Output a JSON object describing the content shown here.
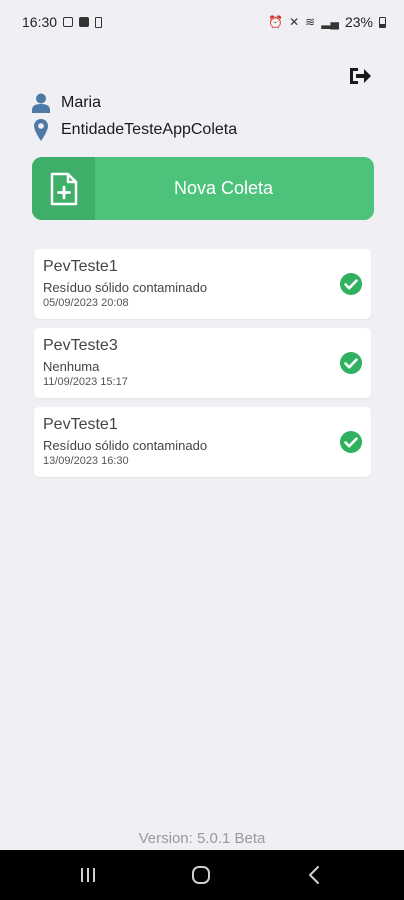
{
  "status_bar": {
    "time": "16:30",
    "battery": "23%"
  },
  "user": {
    "name": "Maria",
    "entity": "EntidadeTesteAppColeta"
  },
  "new_collection": {
    "label": "Nova Coleta"
  },
  "collections": [
    {
      "title": "PevTeste1",
      "description": "Resíduo sólido contaminado",
      "date": "05/09/2023 20:08",
      "status": "check-circle-icon"
    },
    {
      "title": "PevTeste3",
      "description": "Nenhuma",
      "date": "11/09/2023 15:17",
      "status": "check-circle-icon"
    },
    {
      "title": "PevTeste1",
      "description": "Resíduo sólido contaminado",
      "date": "13/09/2023 16:30",
      "status": "check-circle-icon"
    }
  ],
  "footer": {
    "version": "Version: 5.0.1 Beta"
  },
  "icons": {
    "logout": "logout-icon",
    "user": "user-icon",
    "location": "location-pin-icon",
    "new_document": "new-document-icon",
    "nav_recents": "recents-icon",
    "nav_home": "home-icon",
    "nav_back": "back-icon"
  },
  "colors": {
    "background": "#f0f0f4",
    "primary_green": "#4cc27a",
    "primary_green_dark": "#3eae69",
    "icon_blue": "#4e79a7",
    "check_green": "#2fb15f"
  }
}
